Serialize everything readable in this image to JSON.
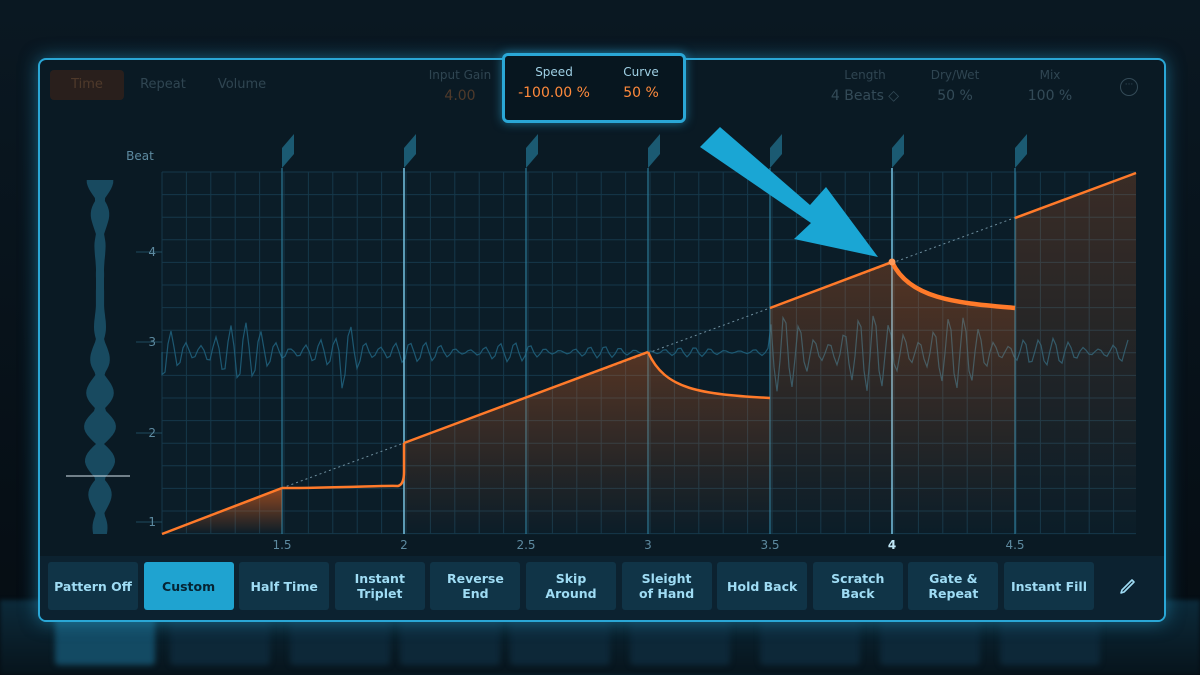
{
  "toolbar": {
    "tabs": [
      {
        "label": "Time",
        "active": true
      },
      {
        "label": "Repeat",
        "active": false
      },
      {
        "label": "Volume",
        "active": false
      }
    ],
    "params": [
      {
        "label": "Input Gain",
        "value": "4.00"
      },
      {
        "label": "Length",
        "value": "4 Beats ◇"
      },
      {
        "label": "Dry/Wet",
        "value": "50 %"
      },
      {
        "label": "Mix",
        "value": "100 %"
      }
    ],
    "menu_icon": "more-icon"
  },
  "highlight": {
    "speed_label": "Speed",
    "speed_value": "-100.00 %",
    "curve_label": "Curve",
    "curve_value": "50 %"
  },
  "graph": {
    "y_axis_title": "Beat",
    "y_ticks": [
      "1",
      "2",
      "3",
      "4"
    ],
    "x_ticks": [
      "1.5",
      "2",
      "2.5",
      "3",
      "3.5",
      "4",
      "4.5"
    ],
    "active_x_tick": "4",
    "accent_color": "#ff7a2a",
    "grid_color": "#2aa7d6",
    "arrow_color": "#1aa6d4"
  },
  "patterns": [
    {
      "label": "Pattern Off",
      "active": false
    },
    {
      "label": "Custom",
      "active": true
    },
    {
      "label": "Half Time",
      "active": false
    },
    {
      "label": "Instant\nTriplet",
      "active": false
    },
    {
      "label": "Reverse End",
      "active": false
    },
    {
      "label": "Skip Around",
      "active": false
    },
    {
      "label": "Sleight\nof Hand",
      "active": false
    },
    {
      "label": "Hold Back",
      "active": false
    },
    {
      "label": "Scratch\nBack",
      "active": false
    },
    {
      "label": "Gate &\nRepeat",
      "active": false
    },
    {
      "label": "Instant Fill",
      "active": false
    }
  ],
  "edit_icon": "pencil-icon"
}
